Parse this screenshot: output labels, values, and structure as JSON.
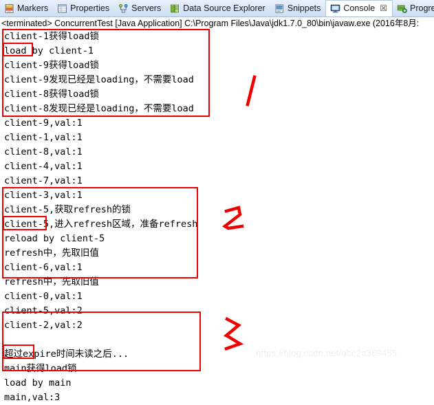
{
  "tabbar": {
    "tabs": [
      {
        "label": "Markers",
        "icon": "markers-icon",
        "active": false,
        "closable": false
      },
      {
        "label": "Properties",
        "icon": "properties-icon",
        "active": false,
        "closable": false
      },
      {
        "label": "Servers",
        "icon": "servers-icon",
        "active": false,
        "closable": false
      },
      {
        "label": "Data Source Explorer",
        "icon": "data-source-explorer-icon",
        "active": false,
        "closable": false
      },
      {
        "label": "Snippets",
        "icon": "snippets-icon",
        "active": false,
        "closable": false
      },
      {
        "label": "Console",
        "icon": "console-icon",
        "active": true,
        "closable": true
      },
      {
        "label": "Progre",
        "icon": "progress-icon",
        "active": false,
        "closable": false
      }
    ],
    "close_glyph": "☒"
  },
  "launch": {
    "description": "<terminated> ConcurrentTest [Java Application] C:\\Program Files\\Java\\jdk1.7.0_80\\bin\\javaw.exe (2016年8月:"
  },
  "console": {
    "lines": [
      "client-1获得load锁",
      "load by client-1",
      "client-9获得load锁",
      "client-9发现已经是loading，不需要load",
      "client-8获得load锁",
      "client-8发现已经是loading，不需要load",
      "client-9,val:1",
      "client-1,val:1",
      "client-8,val:1",
      "client-4,val:1",
      "client-7,val:1",
      "client-3,val:1",
      "client-5,获取refresh的锁",
      "client-5,进入refresh区域，准备refresh",
      "reload by client-5",
      "refresh中，先取旧值",
      "client-6,val:1",
      "refresh中，先取旧值",
      "client-0,val:1",
      "client-5,val:2",
      "client-2,val:2",
      "",
      "超过expire时间未读之后...",
      "main获得load锁",
      "load by main",
      "main,val:3"
    ]
  },
  "annotations": {
    "accent_color": "#ee0000",
    "numbers": [
      {
        "label": "1",
        "name": "handwritten-number-1"
      },
      {
        "label": "2",
        "name": "handwritten-number-2"
      },
      {
        "label": "3",
        "name": "handwritten-number-3"
      }
    ],
    "boxes": [
      {
        "name": "highlight-box-section-1"
      },
      {
        "name": "highlight-box-load-by-client-1"
      },
      {
        "name": "highlight-box-section-2"
      },
      {
        "name": "highlight-box-reload-by-client-5"
      },
      {
        "name": "highlight-box-section-3"
      },
      {
        "name": "highlight-box-load-by-main"
      }
    ]
  },
  "watermark": {
    "text": "https://blog.csdn.net/qbc2d389455"
  }
}
